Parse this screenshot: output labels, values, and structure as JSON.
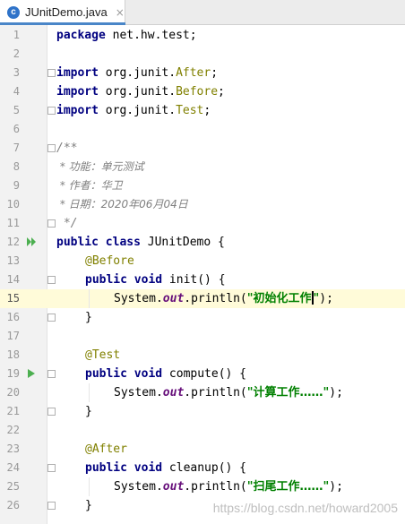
{
  "tab": {
    "icon_letter": "c",
    "title": "JUnitDemo.java",
    "close_glyph": "×"
  },
  "code": {
    "line_numbers": [
      "1",
      "2",
      "3",
      "4",
      "5",
      "6",
      "7",
      "8",
      "9",
      "10",
      "11",
      "12",
      "13",
      "14",
      "15",
      "16",
      "17",
      "18",
      "19",
      "20",
      "21",
      "22",
      "23",
      "24",
      "25",
      "26"
    ],
    "package_kw": "package",
    "package_name": " net.hw.test;",
    "import_kw": "import",
    "import_after_prefix": " org.junit.",
    "import_after_cls": "After",
    "import_before_prefix": " org.junit.",
    "import_before_cls": "Before",
    "import_test_prefix": " org.junit.",
    "import_test_cls": "Test",
    "semicolon": ";",
    "doc_open": "/**",
    "doc_line_func": " * 功能：单元测试",
    "doc_line_author": " * 作者：华卫",
    "doc_line_date": " * 日期：2020年06月04日",
    "doc_close": " */",
    "class_decl_kw": "public class",
    "class_decl_rest": " JUnitDemo {",
    "ann_before": "@Before",
    "ann_test": "@Test",
    "ann_after": "@After",
    "method_kw": "public void",
    "method_init": " init() {",
    "method_compute": " compute() {",
    "method_cleanup": " cleanup() {",
    "println_prefix": "System.",
    "println_out": "out",
    "println_call": ".println(",
    "str_init": "\"初始化工作",
    "str_init_tail": "\"",
    "str_compute": "\"计算工作……\"",
    "str_cleanup": "\"扫尾工作……\"",
    "call_close": ");",
    "brace_close": "}"
  },
  "watermark": "https://blog.csdn.net/howard2005",
  "colors": {
    "keyword": "#000080",
    "annotation": "#808000",
    "string": "#008000",
    "static_field": "#660e7a",
    "comment": "#808080",
    "run_icon": "#4caf50",
    "current_line": "#fffbd9"
  },
  "icons": {
    "run_class": "double-play-icon",
    "run_method": "play-icon",
    "fold": "fold-marker-icon"
  },
  "cursor_line": "15"
}
